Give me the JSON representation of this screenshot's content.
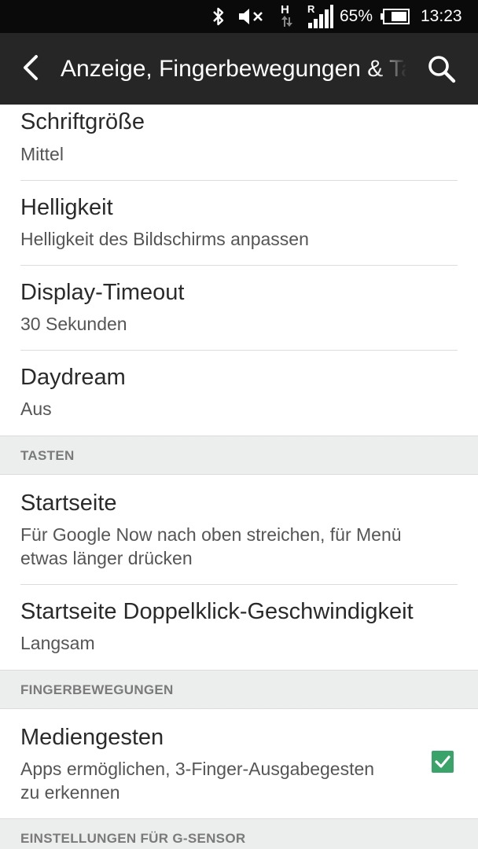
{
  "status_bar": {
    "battery_percent": "65%",
    "time": "13:23",
    "icons": [
      "bluetooth-icon",
      "mute-icon",
      "hspa-data-icon",
      "signal-icon",
      "battery-icon"
    ]
  },
  "app_bar": {
    "title": "Anzeige, Fingerbewegungen & Tasten",
    "back_icon": "back-arrow-icon",
    "search_icon": "search-icon",
    "background": "#262626"
  },
  "settings": {
    "items": [
      {
        "title": "Schriftgröße",
        "summary": "Mittel"
      },
      {
        "title": "Helligkeit",
        "summary": "Helligkeit des Bildschirms anpassen"
      },
      {
        "title": "Display-Timeout",
        "summary": "30 Sekunden"
      },
      {
        "title": "Daydream",
        "summary": "Aus"
      }
    ],
    "sections": [
      {
        "header": "TASTEN",
        "items": [
          {
            "title": "Startseite",
            "summary_line1": "Für Google Now nach oben streichen, für Menü",
            "summary_line2": "etwas länger drücken"
          },
          {
            "title": "Startseite Doppelklick-Geschwindigkeit",
            "summary": "Langsam"
          }
        ]
      },
      {
        "header": "FINGERBEWEGUNGEN",
        "items": [
          {
            "title": "Mediengesten",
            "summary_line1": "Apps ermöglichen, 3-Finger-Ausgabegesten",
            "summary_line2": "zu erkennen",
            "checked": true
          }
        ]
      },
      {
        "header": "EINSTELLUNGEN FÜR G-SENSOR",
        "items": []
      }
    ]
  },
  "colors": {
    "accent_check": "#3aa36a",
    "section_bg": "#eceeed"
  }
}
